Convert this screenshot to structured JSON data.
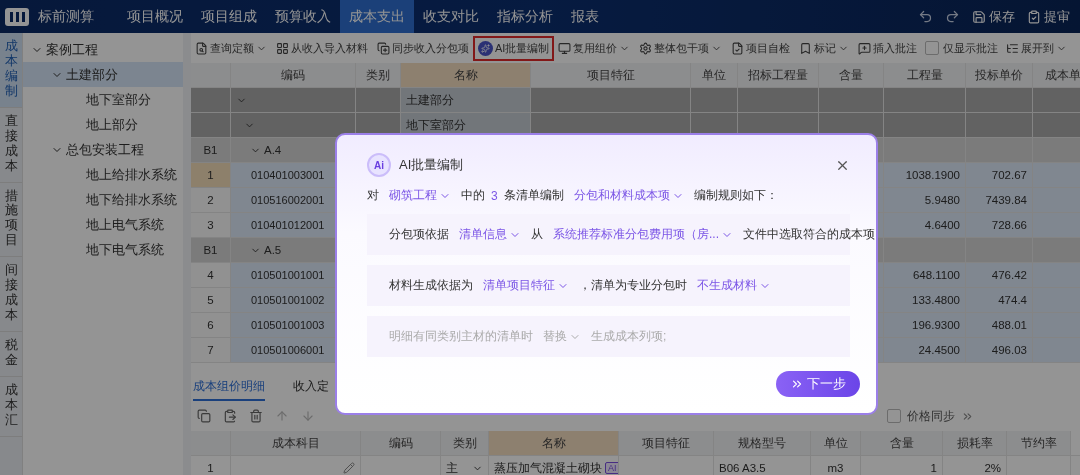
{
  "app": {
    "title": "标前测算"
  },
  "nav": [
    {
      "label": "项目概况",
      "selected": false
    },
    {
      "label": "项目组成",
      "selected": false
    },
    {
      "label": "预算收入",
      "selected": false
    },
    {
      "label": "成本支出",
      "selected": true
    },
    {
      "label": "收支对比",
      "selected": false
    },
    {
      "label": "指标分析",
      "selected": false
    },
    {
      "label": "报表",
      "selected": false
    }
  ],
  "top_actions": [
    {
      "kind": "undo"
    },
    {
      "kind": "redo"
    },
    {
      "kind": "save",
      "label": "保存"
    },
    {
      "kind": "submit",
      "label": "提审"
    }
  ],
  "side_tabs": [
    {
      "label": "成本编制",
      "selected": true
    },
    {
      "label": "直接成本",
      "selected": false
    },
    {
      "label": "措施项目",
      "selected": false
    },
    {
      "label": "间接成本",
      "selected": false
    },
    {
      "label": "税金",
      "selected": false
    },
    {
      "label": "成本汇",
      "selected": false
    }
  ],
  "tree": [
    {
      "label": "案例工程",
      "expanded": true,
      "selected": false,
      "children": [
        {
          "label": "土建部分",
          "expanded": true,
          "selected": true,
          "children": [
            {
              "label": "地下室部分",
              "selected": false
            },
            {
              "label": "地上部分",
              "selected": false
            }
          ]
        },
        {
          "label": "总包安装工程",
          "expanded": true,
          "selected": false,
          "children": [
            {
              "label": "地上给排水系统",
              "selected": false
            },
            {
              "label": "地下给排水系统",
              "selected": false
            },
            {
              "label": "地上电气系统",
              "selected": false
            },
            {
              "label": "地下电气系统",
              "selected": false
            }
          ]
        }
      ]
    }
  ],
  "toolbar": [
    {
      "kind": "query",
      "label": "查询定额",
      "dropdown": true,
      "highlighted": false
    },
    {
      "kind": "import",
      "label": "从收入导入材料",
      "dropdown": false,
      "highlighted": false
    },
    {
      "kind": "sync",
      "label": "同步收入分包项",
      "dropdown": false,
      "highlighted": false
    },
    {
      "kind": "ai",
      "label": "AI批量编制",
      "dropdown": false,
      "highlighted": true
    },
    {
      "kind": "reuse",
      "label": "复用组价",
      "dropdown": true,
      "highlighted": false
    },
    {
      "kind": "settings",
      "label": "整体包干项",
      "dropdown": true,
      "highlighted": false
    },
    {
      "kind": "check",
      "label": "项目自检",
      "dropdown": false,
      "highlighted": false
    },
    {
      "kind": "mark",
      "label": "标记",
      "dropdown": true,
      "highlighted": false
    },
    {
      "kind": "comment",
      "label": "插入批注",
      "dropdown": false,
      "highlighted": false
    },
    {
      "kind": "checkbox",
      "label": "仅显示批注",
      "checked": false
    },
    {
      "kind": "expand",
      "label": "展开到",
      "dropdown": true,
      "highlighted": false
    }
  ],
  "table": {
    "columns": [
      "",
      "编码",
      "类别",
      "名称",
      "项目特征",
      "单位",
      "招标工程量",
      "含量",
      "工程量",
      "投标单价",
      "成本单"
    ],
    "rows": [
      {
        "kind": "group",
        "name": "土建部分",
        "expanded": true
      },
      {
        "kind": "subgroup",
        "name": "地下室部分",
        "expanded": true
      },
      {
        "kind": "section",
        "index": "B1",
        "code": "A.4",
        "expanded": true
      },
      {
        "kind": "item",
        "index": "1",
        "code": "010401003001",
        "quantity": "1038.1900",
        "price": "702.67",
        "selected": true
      },
      {
        "kind": "item",
        "index": "2",
        "code": "010516002001",
        "quantity": "5.9480",
        "price": "7439.84",
        "selected": false
      },
      {
        "kind": "item",
        "index": "3",
        "code": "010401012001",
        "quantity": "4.6400",
        "price": "728.66",
        "selected": false
      },
      {
        "kind": "section",
        "index": "B1",
        "code": "A.5",
        "expanded": true
      },
      {
        "kind": "item",
        "index": "4",
        "code": "010501001001",
        "quantity": "648.1100",
        "price": "476.42",
        "selected": false
      },
      {
        "kind": "item",
        "index": "5",
        "code": "010501001002",
        "quantity": "133.4800",
        "price": "474.4",
        "selected": false
      },
      {
        "kind": "item",
        "index": "6",
        "code": "010501001003",
        "quantity": "196.9300",
        "price": "488.01",
        "selected": false
      },
      {
        "kind": "item",
        "index": "7",
        "code": "010501006001",
        "quantity": "24.4500",
        "price": "496.03",
        "selected": false
      }
    ]
  },
  "detail": {
    "tabs": [
      {
        "label": "成本组价明细",
        "selected": true
      },
      {
        "label": "收入定",
        "selected": false
      }
    ],
    "tools": [
      {
        "kind": "copy",
        "disabled": false
      },
      {
        "kind": "paste",
        "disabled": false
      },
      {
        "kind": "delete",
        "disabled": false
      },
      {
        "kind": "up",
        "disabled": true
      },
      {
        "kind": "down",
        "disabled": true
      }
    ],
    "price_sync": {
      "label": "价格同步",
      "checked": false
    },
    "columns": [
      "",
      "成本科目",
      "编码",
      "类别",
      "名称",
      "项目特征",
      "规格型号",
      "单位",
      "含量",
      "损耗率",
      "节约率"
    ],
    "rows": [
      {
        "index": "1",
        "type": "主",
        "name": "蒸压加气混凝土砌块",
        "badge": "AI",
        "spec": "B06 A3.5",
        "unit": "m3",
        "content": "1",
        "loss": "2%"
      }
    ]
  },
  "dialog": {
    "badge": "Ai",
    "title": "AI批量编制",
    "intro": [
      {
        "kind": "text",
        "text": "对"
      },
      {
        "kind": "select",
        "text": "砌筑工程"
      },
      {
        "kind": "text",
        "text": "中的"
      },
      {
        "kind": "count",
        "text": "3"
      },
      {
        "kind": "text",
        "text": "条清单编制"
      },
      {
        "kind": "select",
        "text": "分包和材料成本项"
      },
      {
        "kind": "text",
        "text": "编制规则如下："
      }
    ],
    "rules": [
      {
        "disabled": false,
        "segments": [
          {
            "kind": "text",
            "text": "分包项依据"
          },
          {
            "kind": "select",
            "text": "清单信息"
          },
          {
            "kind": "text",
            "text": "从"
          },
          {
            "kind": "select",
            "text": "系统推荐标准分包费用项（房..."
          },
          {
            "kind": "text",
            "text": "文件中选取符合的成本项"
          }
        ]
      },
      {
        "disabled": false,
        "segments": [
          {
            "kind": "text",
            "text": "材料生成依据为"
          },
          {
            "kind": "select",
            "text": "清单项目特征"
          },
          {
            "kind": "text",
            "text": "，清单为专业分包时"
          },
          {
            "kind": "select",
            "text": "不生成材料"
          }
        ]
      },
      {
        "disabled": true,
        "segments": [
          {
            "kind": "text",
            "text": "明细有同类别主材的清单时"
          },
          {
            "kind": "select",
            "text": "替换"
          },
          {
            "kind": "text",
            "text": "生成成本列项;"
          }
        ]
      }
    ],
    "next": "下一步"
  }
}
